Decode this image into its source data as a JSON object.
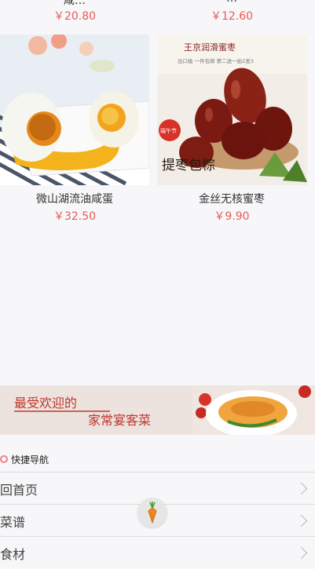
{
  "top_row": {
    "left": {
      "name": "咸…",
      "price": "￥20.80"
    },
    "right": {
      "name": "…",
      "price": "￥12.60"
    }
  },
  "products": [
    {
      "name": "微山湖流油咸蛋",
      "price": "￥32.50"
    },
    {
      "name": "金丝无核蜜枣",
      "price": "￥9.90",
      "image_text": {
        "brand": "王京润滑蜜枣",
        "tagline": "出口级 一件包邮 第二送一拍2发3",
        "badge": "端午节",
        "headline": "提枣包粽"
      }
    }
  ],
  "banner": {
    "line1": "最受欢迎的",
    "line2": "家常宴客菜"
  },
  "quick_nav": {
    "title": "快捷导航",
    "items": [
      {
        "label": "回首页"
      },
      {
        "label": "菜谱"
      },
      {
        "label": "食材"
      }
    ]
  },
  "colors": {
    "price": "#e95a5a",
    "accent_ring": "#f08080"
  },
  "icons": {
    "fab": "carrot-icon",
    "row_arrow": "chevron-right-icon"
  }
}
